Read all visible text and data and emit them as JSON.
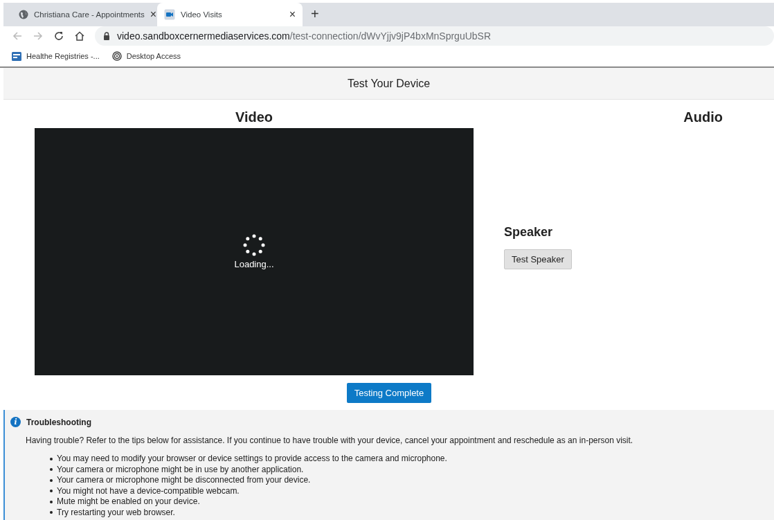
{
  "browser": {
    "tabs": [
      {
        "title": "Christiana Care - Appointments",
        "kind": "globe",
        "selected": false
      },
      {
        "title": "Video Visits",
        "kind": "video",
        "selected": true
      }
    ],
    "new_tab": "+",
    "close": "×",
    "url": {
      "host": "video.sandboxcernermediaservices.com",
      "path": "/test-connection/dWvYjjv9jP4bxMnSprguUbSR"
    },
    "bookmarks": [
      {
        "label": "Healthe Registries -...",
        "kind": "registry"
      },
      {
        "label": "Desktop Access",
        "kind": "spiral"
      }
    ]
  },
  "header": {
    "title": "Test Your Device"
  },
  "video": {
    "heading": "Video",
    "loading": "Loading..."
  },
  "audio": {
    "heading": "Audio",
    "speaker": {
      "heading": "Speaker",
      "button": "Test Speaker"
    }
  },
  "complete_button": "Testing Complete",
  "troubleshooting": {
    "icon": "i",
    "title": "Troubleshooting",
    "intro": "Having trouble? Refer to the tips below for assistance. If you continue to have trouble with your device, cancel your appointment and reschedule as an in-person visit.",
    "tips": [
      "You may need to modify your browser or device settings to provide access to the camera and microphone.",
      "Your camera or microphone might be in use by another application.",
      "Your camera or microphone might be disconnected from your device.",
      "You might not have a device-compatible webcam.",
      "Mute might be enabled on your device.",
      "Try restarting your web browser."
    ]
  }
}
